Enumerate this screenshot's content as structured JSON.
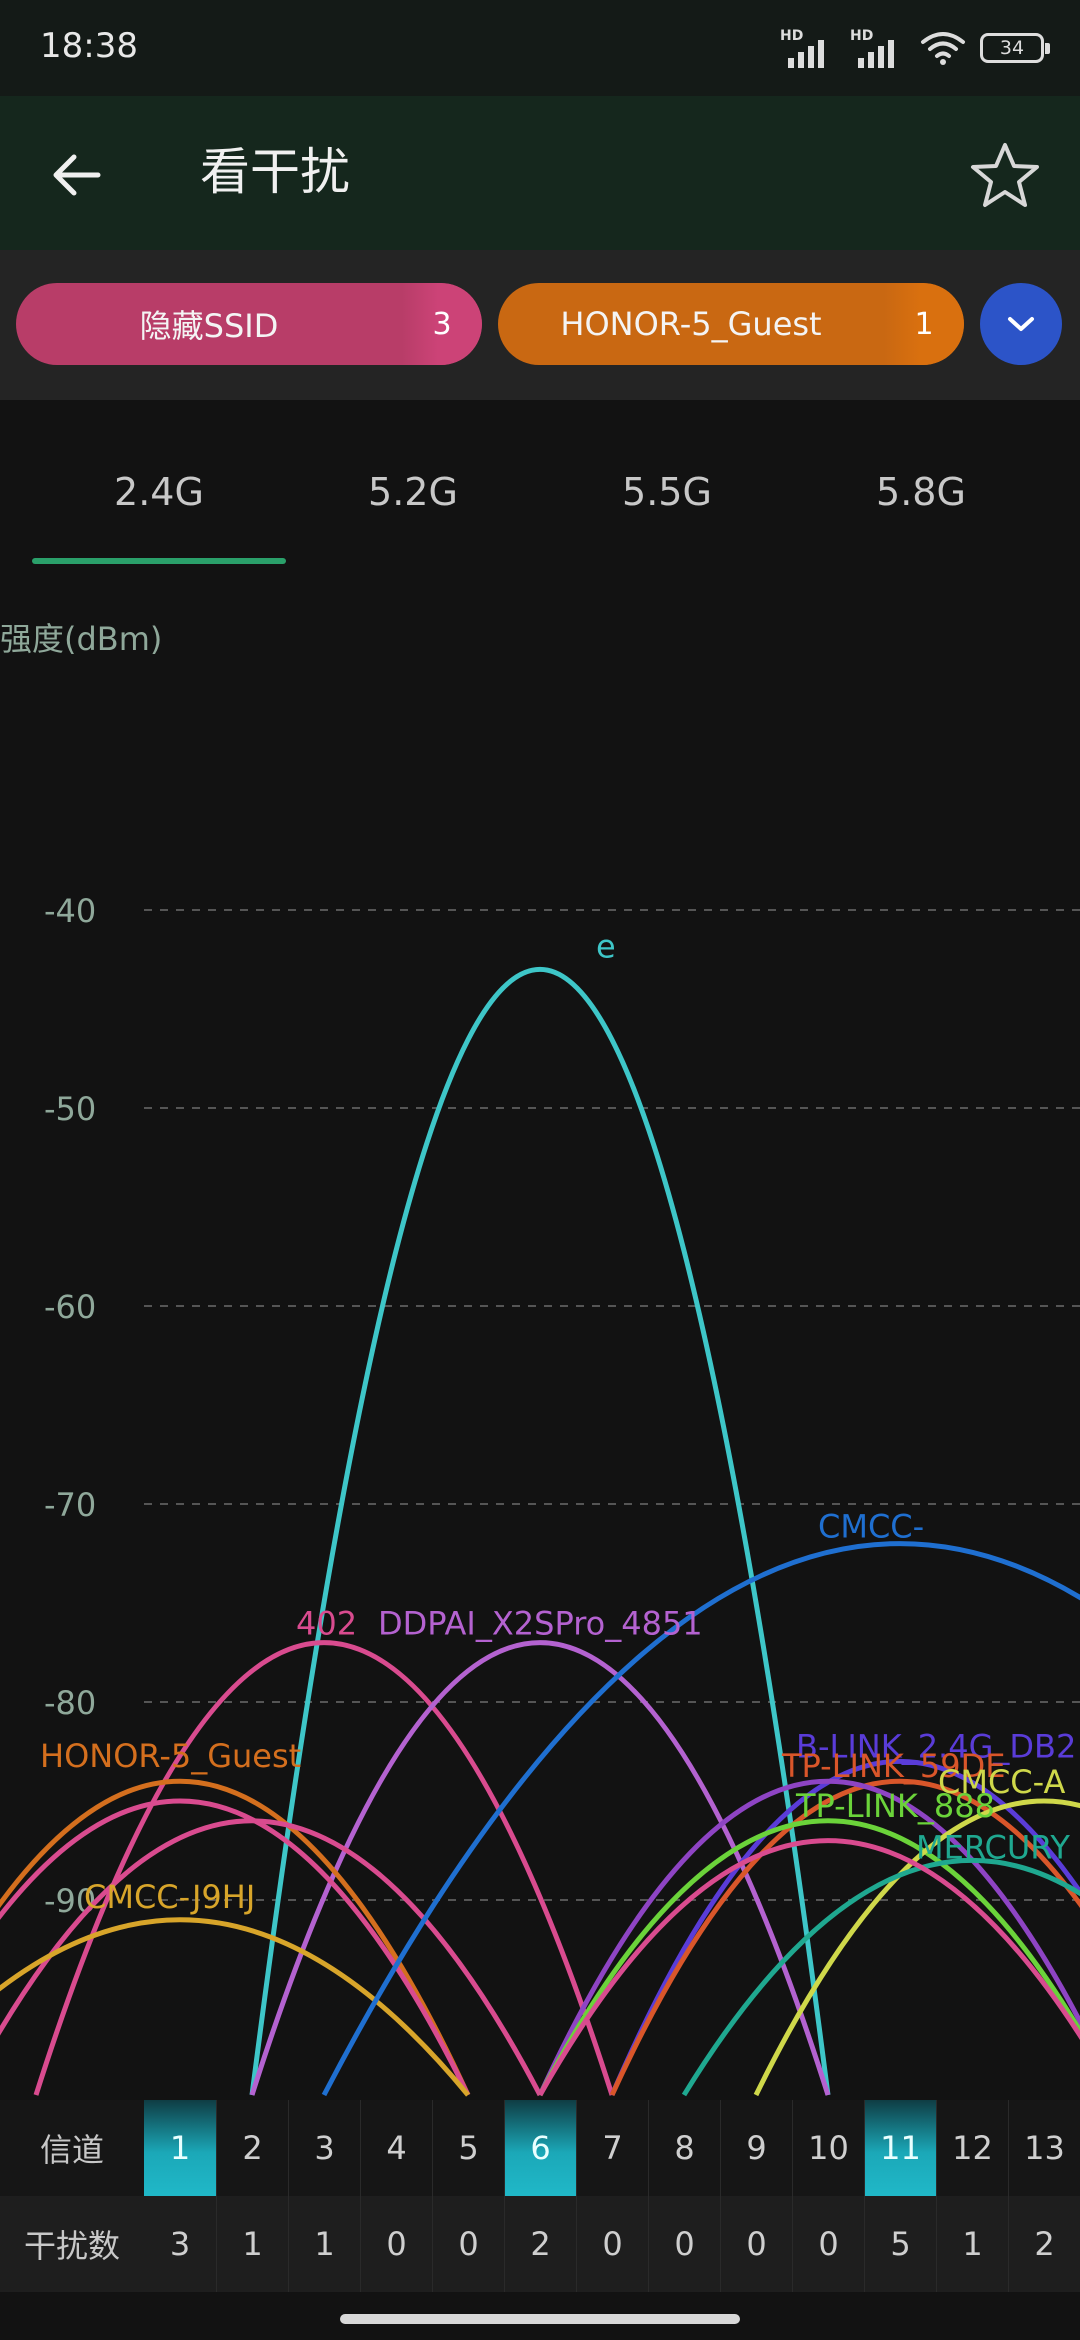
{
  "status": {
    "time": "18:38",
    "sim1": "HD",
    "sim2": "HD",
    "battery": "34"
  },
  "app_bar": {
    "title": "看干扰"
  },
  "chips": [
    {
      "label": "隐藏SSID",
      "count": "3",
      "color": "#b83d68"
    },
    {
      "label": "HONOR-5_Guest",
      "count": "1",
      "color": "#c96812"
    }
  ],
  "tabs": [
    "2.4G",
    "5.2G",
    "5.5G",
    "5.8G"
  ],
  "active_tab": "2.4G",
  "channels": {
    "row_label": "信道",
    "numbers": [
      "1",
      "2",
      "3",
      "4",
      "5",
      "6",
      "7",
      "8",
      "9",
      "10",
      "11",
      "12",
      "13"
    ],
    "highlighted": [
      "1",
      "6",
      "11"
    ]
  },
  "interference": {
    "row_label": "干扰数",
    "counts": [
      "3",
      "1",
      "1",
      "0",
      "0",
      "2",
      "0",
      "0",
      "0",
      "0",
      "5",
      "1",
      "2"
    ]
  },
  "chart_data": {
    "type": "area",
    "ylabel": "强度(dBm)",
    "y_ticks": [
      "-40",
      "-50",
      "-60",
      "-70",
      "-80",
      "-90"
    ],
    "ylim": [
      -100,
      -30
    ],
    "x": [
      1,
      2,
      3,
      4,
      5,
      6,
      7,
      8,
      9,
      10,
      11,
      12,
      13
    ],
    "series": [
      {
        "name": "",
        "center": 6,
        "width": 40,
        "peak": -43,
        "color": "#3ec6c8",
        "label_visible": "e"
      },
      {
        "name": "402",
        "center": 3,
        "width": 40,
        "peak": -77,
        "color": "#d94b8f"
      },
      {
        "name": "DDPAI_X2SPro_4851",
        "center": 6,
        "width": 40,
        "peak": -77,
        "color": "#b462d0"
      },
      {
        "name": "HONOR-5_Guest",
        "center": 1,
        "width": 40,
        "peak": -84,
        "color": "#d46f1e"
      },
      {
        "name": "",
        "center": 1,
        "width": 40,
        "peak": -85,
        "color": "#d94b8f"
      },
      {
        "name": "",
        "center": 2,
        "width": 40,
        "peak": -86,
        "color": "#d94b8f"
      },
      {
        "name": "CMCC-J9HJ",
        "center": 1,
        "width": 40,
        "peak": -91,
        "color": "#d8a52a"
      },
      {
        "name": "CMCC-",
        "center": 11,
        "width": 80,
        "peak": -72,
        "color": "#1f6fd0"
      },
      {
        "name": "B-LINK_2.4G_DB2",
        "center": 11,
        "width": 40,
        "peak": -83,
        "color": "#5a3cd8"
      },
      {
        "name": "TP-LINK_59DE",
        "center": 11,
        "width": 40,
        "peak": -84,
        "color": "#d9562a"
      },
      {
        "name": "",
        "center": 10,
        "width": 40,
        "peak": -84,
        "color": "#8e44c4"
      },
      {
        "name": "TP-LINK_888",
        "center": 10,
        "width": 40,
        "peak": -86,
        "color": "#6bd33a"
      },
      {
        "name": "CMCC-A",
        "center": 13,
        "width": 40,
        "peak": -85,
        "color": "#cfd84a"
      },
      {
        "name": "MERCURY",
        "center": 12,
        "width": 40,
        "peak": -88,
        "color": "#1fa890"
      },
      {
        "name": "",
        "center": 10,
        "width": 40,
        "peak": -87,
        "color": "#d94b8f"
      }
    ]
  }
}
